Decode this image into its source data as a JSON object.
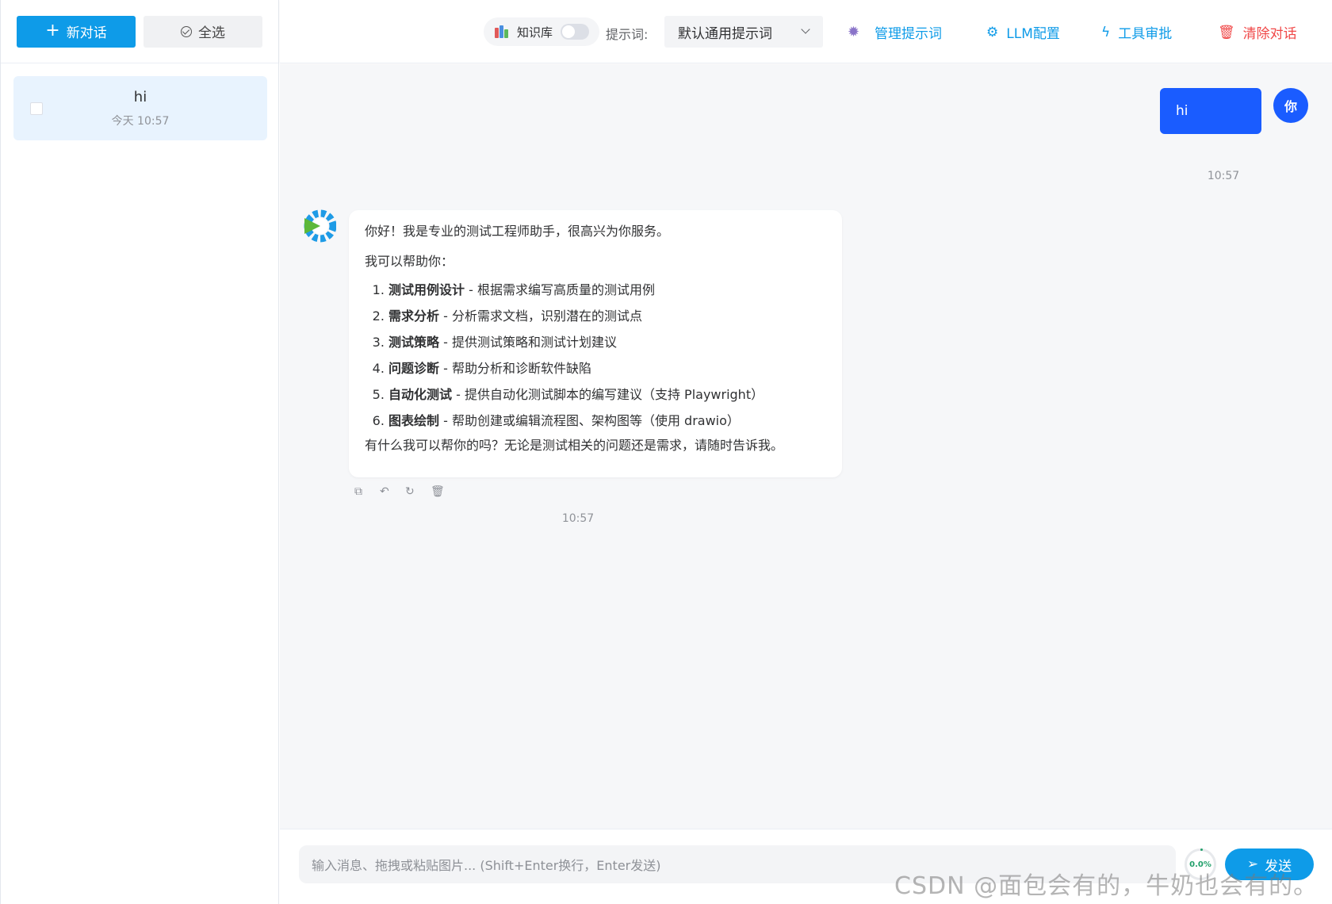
{
  "sidebar": {
    "new_chat_label": "新对话",
    "select_all_label": "全选",
    "conversations": [
      {
        "title": "hi",
        "time": "今天 10:57"
      }
    ]
  },
  "topbar": {
    "knowledge_base_label": "知识库",
    "prompt_label": "提示词:",
    "prompt_selected": "默认通用提示词",
    "manage_prompts_label": "管理提示词",
    "llm_config_label": "LLM配置",
    "tool_approval_label": "工具审批",
    "clear_chat_label": "清除对话"
  },
  "chat": {
    "user_message": "hi",
    "user_avatar": "你",
    "user_time": "10:57",
    "bot_intro": "你好！我是专业的测试工程师助手，很高兴为你服务。",
    "bot_help": "我可以帮助你：",
    "bot_items": [
      {
        "title": "测试用例设计",
        "desc": " - 根据需求编写高质量的测试用例"
      },
      {
        "title": "需求分析",
        "desc": " - 分析需求文档，识别潜在的测试点"
      },
      {
        "title": "测试策略",
        "desc": " - 提供测试策略和测试计划建议"
      },
      {
        "title": "问题诊断",
        "desc": " - 帮助分析和诊断软件缺陷"
      },
      {
        "title": "自动化测试",
        "desc": " - 提供自动化测试脚本的编写建议（支持 Playwright）"
      },
      {
        "title": "图表绘制",
        "desc": " - 帮助创建或编辑流程图、架构图等（使用 drawio）"
      }
    ],
    "bot_outro": "有什么我可以帮你的吗？无论是测试相关的问题还是需求，请随时告诉我。",
    "bot_time": "10:57"
  },
  "input": {
    "placeholder": "输入消息、拖拽或粘贴图片... (Shift+Enter换行，Enter发送)",
    "context_usage": "0.0%",
    "send_label": "发送"
  },
  "watermark": "CSDN @面包会有的，牛奶也会有的。",
  "colors": {
    "primary": "#0e9be8",
    "user_bubble": "#1a5cff",
    "danger": "#f04848"
  }
}
